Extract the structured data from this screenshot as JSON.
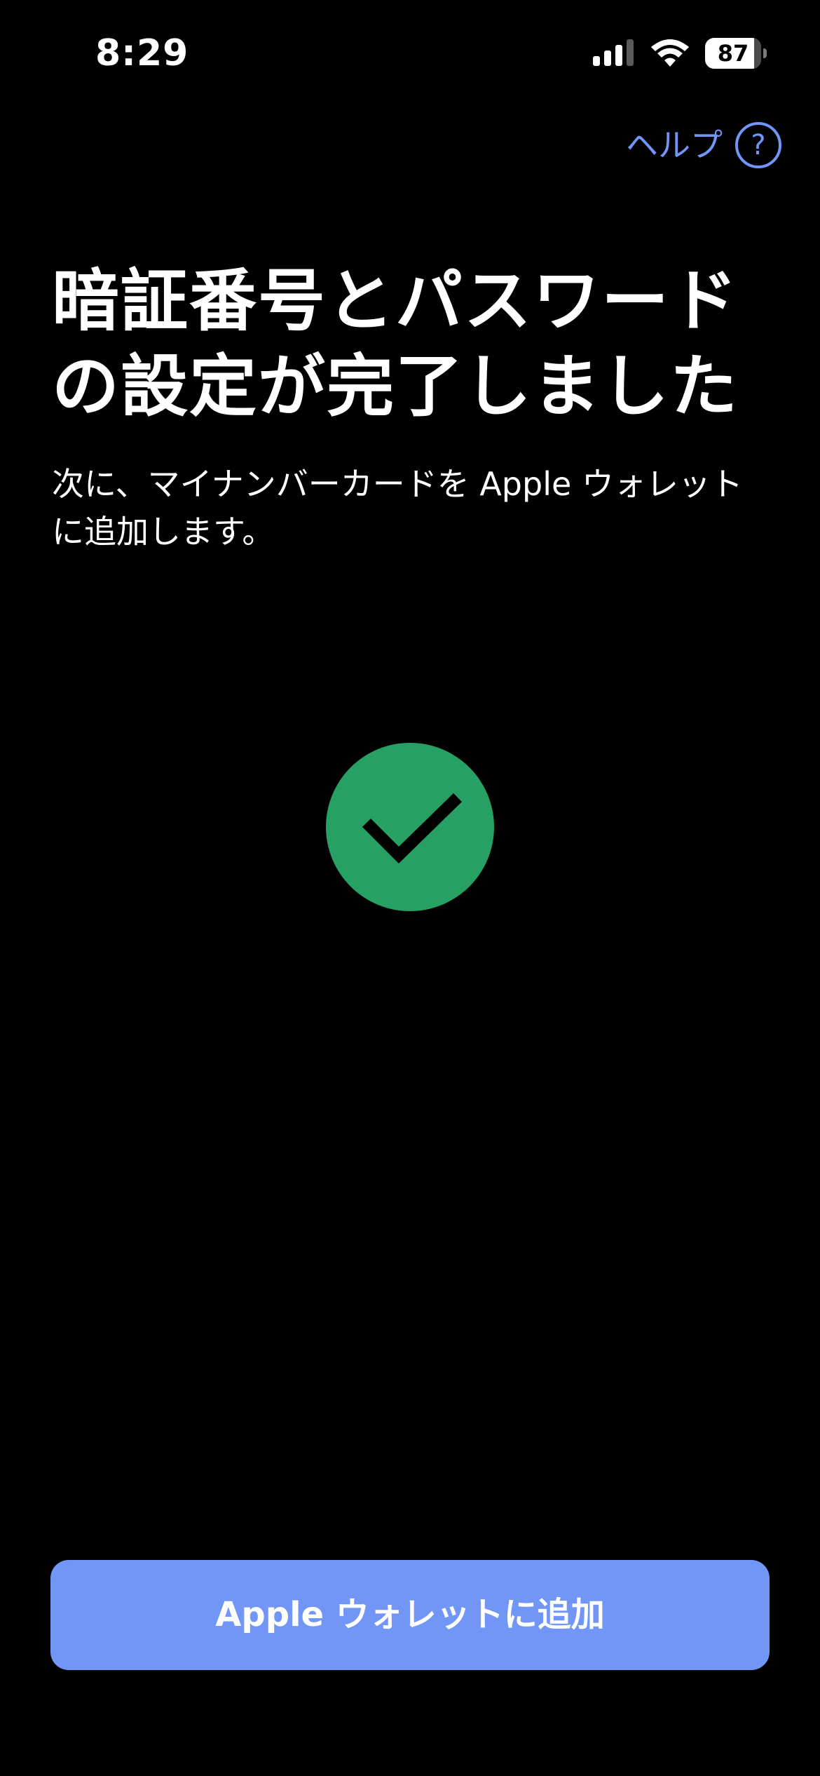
{
  "status_bar": {
    "time": "8:29",
    "battery_level": "87",
    "battery_fraction": 0.87,
    "signal_icon": "cellular-signal-icon",
    "wifi_icon": "wifi-icon",
    "battery_icon": "battery-icon"
  },
  "header": {
    "help_label": "ヘルプ",
    "help_icon_glyph": "?"
  },
  "content": {
    "title_line1": "暗証番号とパスワード",
    "title_line2": "の設定が完了しました",
    "description_line1": "次に、マイナンバーカードを Apple ウォレット",
    "description_line2": "に追加します。",
    "success_icon": "checkmark-circle-icon"
  },
  "actions": {
    "primary_label": "Apple ウォレットに追加"
  },
  "colors": {
    "background": "#000000",
    "accent": "#7296f6",
    "success": "#26a163",
    "text": "#ffffff"
  }
}
